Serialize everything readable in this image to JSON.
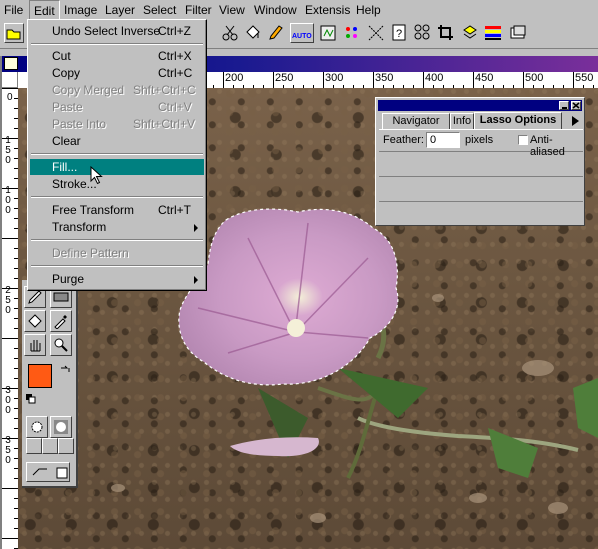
{
  "menubar": {
    "items": [
      "File",
      "Edit",
      "Image",
      "Layer",
      "Select",
      "Filter",
      "View",
      "Window",
      "Extensis",
      "Help"
    ],
    "active": "Edit"
  },
  "toolbar": {
    "icons": [
      "open-icon",
      "cut-icon",
      "copy-icon",
      "paste-icon",
      "paint-bucket-icon",
      "brush-icon",
      "auto-icon",
      "fx-icon",
      "sharpen-icon",
      "ants-icon",
      "help-icon",
      "levels-icon",
      "crop-icon",
      "rotate-icon",
      "gradient-icon",
      "layers-icon"
    ],
    "auto_label": "AUTO"
  },
  "edit_menu": {
    "items": [
      {
        "label": "Undo Select Inverse",
        "shortcut": "Ctrl+Z",
        "enabled": true
      },
      {
        "label": "Cut",
        "shortcut": "Ctrl+X",
        "enabled": true
      },
      {
        "label": "Copy",
        "shortcut": "Ctrl+C",
        "enabled": true
      },
      {
        "label": "Copy Merged",
        "shortcut": "Shft+Ctrl+C",
        "enabled": false
      },
      {
        "label": "Paste",
        "shortcut": "Ctrl+V",
        "enabled": false
      },
      {
        "label": "Paste Into",
        "shortcut": "Shft+Ctrl+V",
        "enabled": false
      },
      {
        "label": "Clear",
        "shortcut": "",
        "enabled": true
      },
      {
        "label": "Fill...",
        "shortcut": "",
        "enabled": true,
        "highlighted": true
      },
      {
        "label": "Stroke...",
        "shortcut": "",
        "enabled": true
      },
      {
        "label": "Free Transform",
        "shortcut": "Ctrl+T",
        "enabled": true
      },
      {
        "label": "Transform",
        "shortcut": "",
        "enabled": true,
        "submenu": true
      },
      {
        "label": "Define Pattern",
        "shortcut": "",
        "enabled": false
      },
      {
        "label": "Purge",
        "shortcut": "",
        "enabled": true,
        "submenu": true
      }
    ]
  },
  "rulers": {
    "horizontal": [
      "200",
      "250",
      "300",
      "350",
      "400",
      "450",
      "500",
      "550"
    ],
    "vertical": [
      [
        "1",
        "5",
        "0"
      ],
      [
        "1",
        "0",
        "0"
      ],
      [
        "2",
        "5",
        "0"
      ],
      [
        "3",
        "0",
        "0"
      ],
      [
        "3",
        "5",
        "0"
      ]
    ],
    "top_left_zero": "0"
  },
  "lasso_options": {
    "tabs": [
      "Navigator",
      "Info",
      "Lasso Options"
    ],
    "active_tab": "Lasso Options",
    "feather_label": "Feather:",
    "feather_value": "0",
    "feather_unit": "pixels",
    "anti_aliased_label": "Anti-aliased",
    "anti_aliased_checked": false
  },
  "toolbox": {
    "foreground_color": "#ff5a14",
    "background_color": "#000000"
  },
  "colors": {
    "title_bar": "#000080",
    "menu_highlight": "#008080",
    "chrome": "#c0c0c0"
  }
}
